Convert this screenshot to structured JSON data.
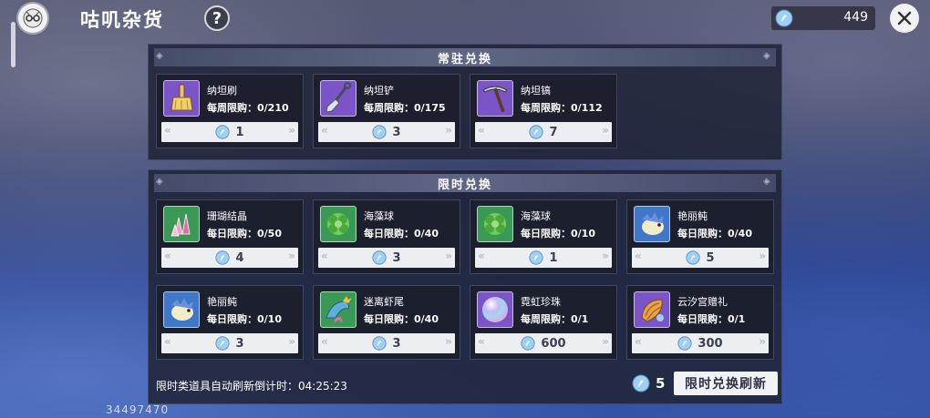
{
  "header": {
    "title": "咕叽杂货",
    "help_label": "?",
    "currency_amount": "449",
    "user_id": "34497470"
  },
  "regular_section": {
    "title": "常驻兑换",
    "items": [
      {
        "name": "纳坦刷",
        "limit": "每周限购：0/210",
        "price": "1",
        "icon": "brush-icon"
      },
      {
        "name": "纳坦铲",
        "limit": "每周限购：0/175",
        "price": "3",
        "icon": "shovel-icon"
      },
      {
        "name": "纳坦镐",
        "limit": "每周限购：0/112",
        "price": "7",
        "icon": "pickaxe-icon"
      }
    ]
  },
  "limited_section": {
    "title": "限时兑换",
    "items": [
      {
        "name": "珊瑚结晶",
        "limit": "每日限购：0/50",
        "price": "4",
        "icon": "coral-crystal-icon",
        "bg": "#3a9a55"
      },
      {
        "name": "海藻球",
        "limit": "每日限购：0/40",
        "price": "3",
        "icon": "seaweed-ball-icon",
        "bg": "#3a9a55"
      },
      {
        "name": "海藻球",
        "limit": "每日限购：0/10",
        "price": "1",
        "icon": "seaweed-ball-icon",
        "bg": "#3a9a55"
      },
      {
        "name": "艳丽鲀",
        "limit": "每日限购：0/40",
        "price": "5",
        "icon": "pufferfish-icon",
        "bg": "#3f78c8"
      },
      {
        "name": "艳丽鲀",
        "limit": "每日限购：0/10",
        "price": "3",
        "icon": "pufferfish-icon",
        "bg": "#3f78c8"
      },
      {
        "name": "迷离虾尾",
        "limit": "每日限购：0/40",
        "price": "3",
        "icon": "shrimp-tail-icon",
        "bg": "#3a9a55"
      },
      {
        "name": "霓虹珍珠",
        "limit": "每周限购：0/1",
        "price": "600",
        "icon": "pearl-icon",
        "bg": "#7b55c8"
      },
      {
        "name": "云汐宫赠礼",
        "limit": "每日限购：0/1",
        "price": "300",
        "icon": "gift-shell-icon",
        "bg": "#7b55c8"
      }
    ],
    "refresh_timer": "限时类道具自动刷新倒计时：04:25:23",
    "refresh_cost": "5",
    "refresh_button": "限时兑换刷新"
  },
  "colors": {
    "coin": "#8fc7ee",
    "regular_icon_bg": "#7b55c8"
  }
}
